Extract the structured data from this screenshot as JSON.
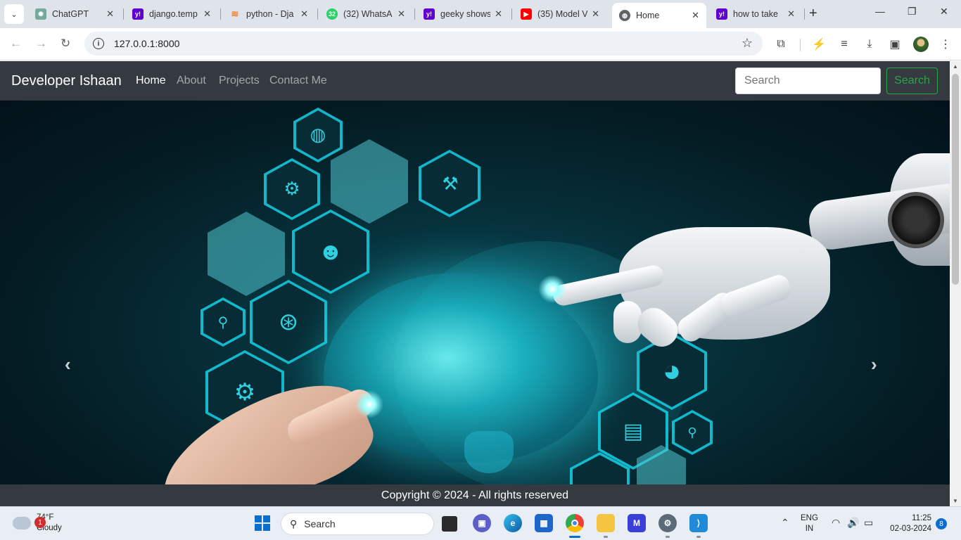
{
  "browser": {
    "tabs": [
      {
        "title": "ChatGPT",
        "favicon_color": "#74aa9c"
      },
      {
        "title": "django.temp",
        "favicon_color": "#6001d2"
      },
      {
        "title": "python - Dja",
        "favicon_color": "#f48024"
      },
      {
        "title": "(32) WhatsA",
        "favicon_color": "#25d366"
      },
      {
        "title": "geeky shows",
        "favicon_color": "#6001d2"
      },
      {
        "title": "(35) Model V",
        "favicon_color": "#ff0000"
      },
      {
        "title": "Home",
        "favicon_color": "#5f6368"
      },
      {
        "title": "how to take",
        "favicon_color": "#6001d2"
      }
    ],
    "whatsapp_count": "32",
    "url": "127.0.0.1:8000"
  },
  "site": {
    "brand": "Developer Ishaan",
    "nav": [
      "Home",
      "About",
      "Projects",
      "Contact Me"
    ],
    "search_placeholder": "Search",
    "search_button": "Search",
    "footer": "Copyright © 2024 - All rights reserved"
  },
  "taskbar": {
    "weather_temp": "74°F",
    "weather_desc": "Cloudy",
    "weather_badge": "1",
    "search_label": "Search",
    "lang_top": "ENG",
    "lang_bottom": "IN",
    "time": "11:25",
    "date": "02-03-2024",
    "notifications": "8"
  },
  "colors": {
    "navbar_bg": "#343a40",
    "search_button": "#28a745",
    "carousel_accent": "#2fd0e0"
  }
}
